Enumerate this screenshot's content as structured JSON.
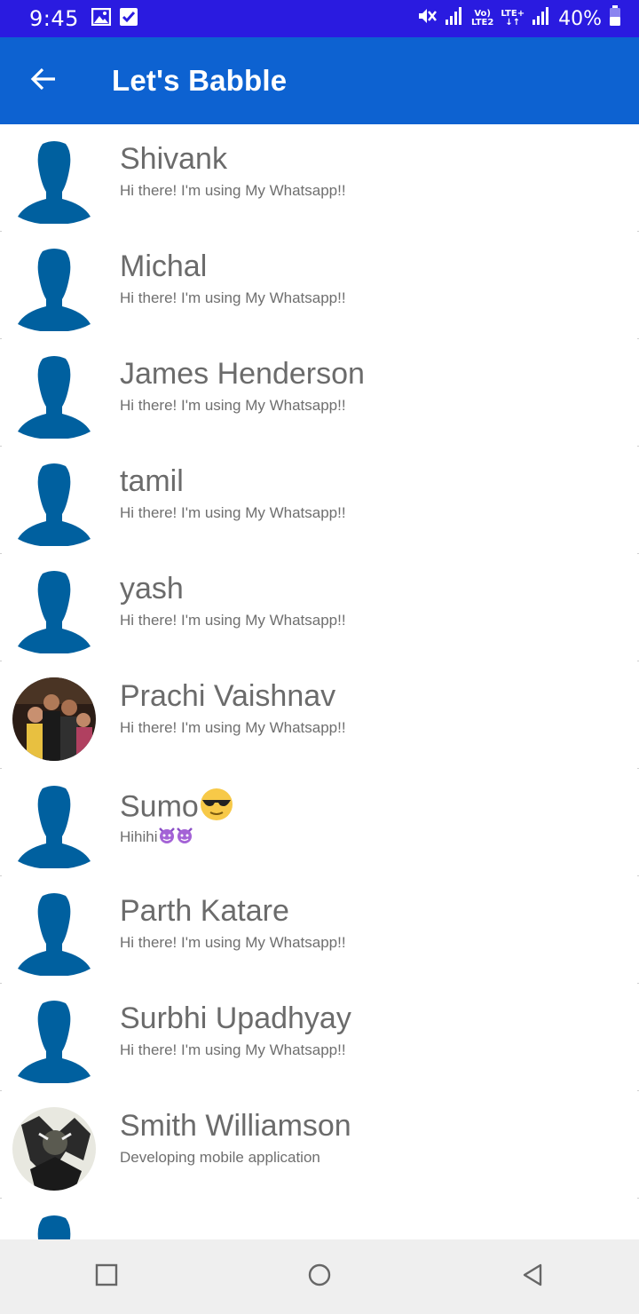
{
  "status_bar": {
    "time": "9:45",
    "volte_top": "Vo)",
    "volte_bottom": "LTE2",
    "lte_label": "LTE+",
    "battery": "40%",
    "icons": [
      "image-icon",
      "checkbox-icon",
      "mute-icon",
      "signal-icon",
      "signal-icon",
      "battery-icon"
    ]
  },
  "app_bar": {
    "title": "Let's Babble",
    "back_icon": "arrow-left-icon"
  },
  "contacts": [
    {
      "name": "Shivank",
      "status": "Hi there! I'm using My Whatsapp!!",
      "avatar": "default-avatar-icon"
    },
    {
      "name": "Michal",
      "status": "Hi there! I'm using My Whatsapp!!",
      "avatar": "default-avatar-icon"
    },
    {
      "name": "James Henderson",
      "status": "Hi there! I'm using My Whatsapp!!",
      "avatar": "default-avatar-icon"
    },
    {
      "name": "tamil",
      "status": "Hi there! I'm using My Whatsapp!!",
      "avatar": "default-avatar-icon"
    },
    {
      "name": "yash",
      "status": "Hi there! I'm using My Whatsapp!!",
      "avatar": "default-avatar-icon"
    },
    {
      "name": "Prachi Vaishnav",
      "status": "Hi there! I'm using My Whatsapp!!",
      "avatar": "photo-avatar"
    },
    {
      "name": "Sumo",
      "status": "Hihihi",
      "avatar": "default-avatar-icon",
      "name_emoji": "sunglasses-emoji-icon",
      "status_emoji": "devil-emoji-icon"
    },
    {
      "name": "Parth Katare",
      "status": "Hi there! I'm using My Whatsapp!!",
      "avatar": "default-avatar-icon"
    },
    {
      "name": "Surbhi Upadhyay",
      "status": "Hi there! I'm using My Whatsapp!!",
      "avatar": "default-avatar-icon"
    },
    {
      "name": "Smith Williamson",
      "status": "Developing mobile application",
      "avatar": "photo-avatar"
    },
    {
      "name": "",
      "status": "",
      "avatar": "default-avatar-icon"
    }
  ],
  "nav_bar": {
    "icons": [
      "recents-square-icon",
      "home-circle-icon",
      "back-triangle-icon"
    ]
  },
  "colors": {
    "status_bar": "#2a1be0",
    "app_bar": "#0d62d1",
    "avatar_default": "#00609f",
    "text_primary": "#6b6b6b",
    "nav_bar": "#efefef"
  }
}
